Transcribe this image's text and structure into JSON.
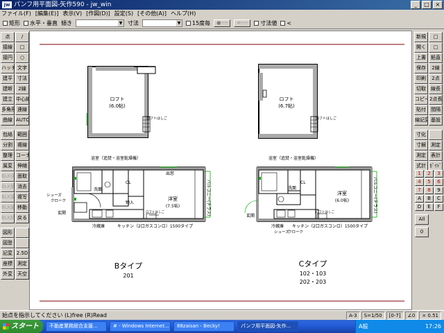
{
  "window": {
    "app_icon": "jw",
    "title": "パンフ用平面図-矢作590 - jw_win",
    "controls": [
      "_",
      "□",
      "×"
    ]
  },
  "menu": [
    "ファイル(F)",
    "[編集(E)]",
    "表示(V)",
    "[作図(D)]",
    "設定(S)",
    "[その他(A)]",
    "ヘルプ(H)"
  ],
  "toolbar": {
    "rect_label": "矩形",
    "horizontal_vertical_label": "水平・垂直",
    "line_type_label": "傾き",
    "dimension_label": "寸法",
    "angle15_label": "15度毎",
    "btn1": "●----",
    "btn2": "<----",
    "dim_value_label": "寸法値",
    "lt_symbol": "<"
  },
  "left_toolbar": [
    [
      "点",
      "/"
    ],
    [
      "接線",
      "□"
    ],
    [
      "接円",
      "○"
    ],
    [
      "ハッチ",
      "文字"
    ],
    [
      "建平",
      "寸法"
    ],
    [
      "建断",
      "2線"
    ],
    [
      "建立",
      "中心線"
    ],
    [
      "多角形",
      "連線"
    ],
    [
      "曲線",
      "AUTO"
    ],
    [
      "包絡",
      "範囲"
    ],
    [
      "分割",
      "複線"
    ],
    [
      "整理",
      "コーナー"
    ],
    [
      "属変",
      "伸縮"
    ],
    [
      "BLK化",
      "面取"
    ],
    [
      "BLK解",
      "消去"
    ],
    [
      "BLK属",
      "複写"
    ],
    [
      "BLK編",
      "移動"
    ],
    [
      "BLK終",
      "戻る"
    ],
    [
      "図形",
      ""
    ],
    [
      "図登",
      ""
    ],
    [
      "記変",
      "2.5D"
    ],
    [
      "座標",
      "測定"
    ],
    [
      "外変",
      "天空"
    ]
  ],
  "right_toolbar": [
    [
      "新規",
      "□"
    ],
    [
      "開く",
      "□"
    ],
    [
      "上書",
      "鉛直"
    ],
    [
      "保存",
      "2線"
    ],
    [
      "印刷",
      "2点"
    ],
    [
      "切取",
      "線長"
    ],
    [
      "コピー",
      "2点長"
    ],
    [
      "貼付",
      "間隔"
    ],
    [
      "線記変",
      "基設"
    ],
    [
      "寸化",
      ""
    ],
    [
      "寸解",
      "測定"
    ],
    [
      "測定",
      "表計"
    ],
    [
      "式計",
      "ｶﾞｲﾄﾞ"
    ]
  ],
  "layer_panel": {
    "numbers": [
      "1",
      "2",
      "3",
      "4",
      "5",
      "6",
      "7",
      "8",
      "9",
      "A",
      "B",
      "C",
      "D",
      "E",
      "F"
    ],
    "all_label": "All",
    "zero_label": "0"
  },
  "drawing": {
    "loft_b_title": "ロフト",
    "loft_b_size": "(6.0帖)",
    "loft_c_title": "ロフト",
    "loft_c_size": "(6.7帖)",
    "loft_ladder": "ロフトはしご",
    "bath_label": "浴室（追焚・浴室乾燥機）",
    "washroom": "洗面",
    "cl": "CL",
    "storage": "物入",
    "window": "出窓",
    "room_b": "洋室",
    "room_b_size": "(7.5帖)",
    "room_c": "洋室",
    "room_c_size": "(6.0帖)",
    "balcony": "バルコニー(テラス)",
    "shoes": "シューズ",
    "cloak": "クローク",
    "entrance": "玄関",
    "fridge": "冷蔵庫",
    "kitchen": "キッチン（2口ガスコンロ）1500タイプ",
    "type_b": "Bタイプ",
    "type_b_rooms": "201",
    "type_c": "Cタイプ",
    "type_c_rooms_1": "102・103",
    "type_c_rooms_2": "202・203"
  },
  "status": {
    "message": "始点を指示してください  (L)free  (R)Read",
    "cells": [
      "A-3",
      "S=1/50",
      "[0-7]",
      "∠0",
      "× 0.51"
    ]
  },
  "taskbar": {
    "start_label": "スタート",
    "tasks": [
      "不動産業務総合支援...",
      "# - Windows Internet...",
      "88zaisan - Becky!",
      "パンフ用平面図-矢作..."
    ],
    "tray_ime": "A般",
    "clock": "17:26"
  }
}
